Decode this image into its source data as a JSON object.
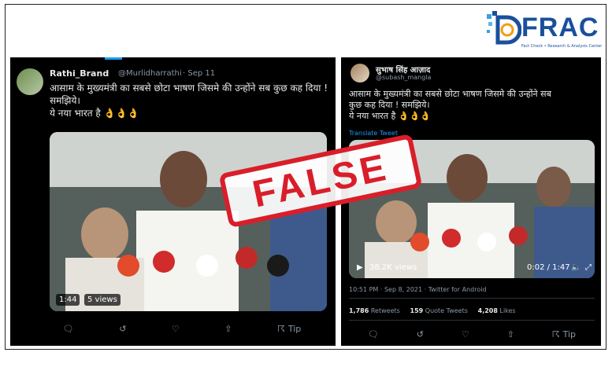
{
  "brand": {
    "logo_text": "FRAC",
    "logo_sub": "Fact Check • Research & Analysis Center"
  },
  "stamp": {
    "label": "FALSE"
  },
  "tweet_left": {
    "name": "Rathi_Brand",
    "handle": "@Murlidharrathi",
    "date": "· Sep 11",
    "line1": "आसाम के मुख्यमंत्री का सबसे छोटा भाषण जिसमे की उन्होंने सब कुछ कह दिया !",
    "line2": "समझिये।",
    "line3": "ये नया भारत है 👌👌👌",
    "video_time": "1:44",
    "video_views": "5 views",
    "tip_label": "Tip"
  },
  "tweet_right": {
    "name": "सुभाष सिंह आज़ाद",
    "handle": "@subash_mangla",
    "line1": "आसाम के मुख्यमंत्री का सबसे छोटा भाषण जिसमे की उन्होंने सब",
    "line2": "कुछ कह दिया !  समझिये।",
    "line3": "ये नया भारत है 👌👌👌",
    "translate": "Translate Tweet",
    "video_views": "38.2K views",
    "video_time": "0:02 / 1:47",
    "meta": "10:51 PM · Sep 8, 2021 · Twitter for Android",
    "retweets_count": "1,786",
    "retweets_label": "Retweets",
    "quotes_count": "159",
    "quotes_label": "Quote Tweets",
    "likes_count": "4,208",
    "likes_label": "Likes",
    "tip_label": "Tip"
  },
  "colors": {
    "stamp_red": "#d91e2a",
    "brand_blue": "#1a4f9c",
    "twitter_blue": "#1d9bf0",
    "tweet_bg": "#000000"
  }
}
